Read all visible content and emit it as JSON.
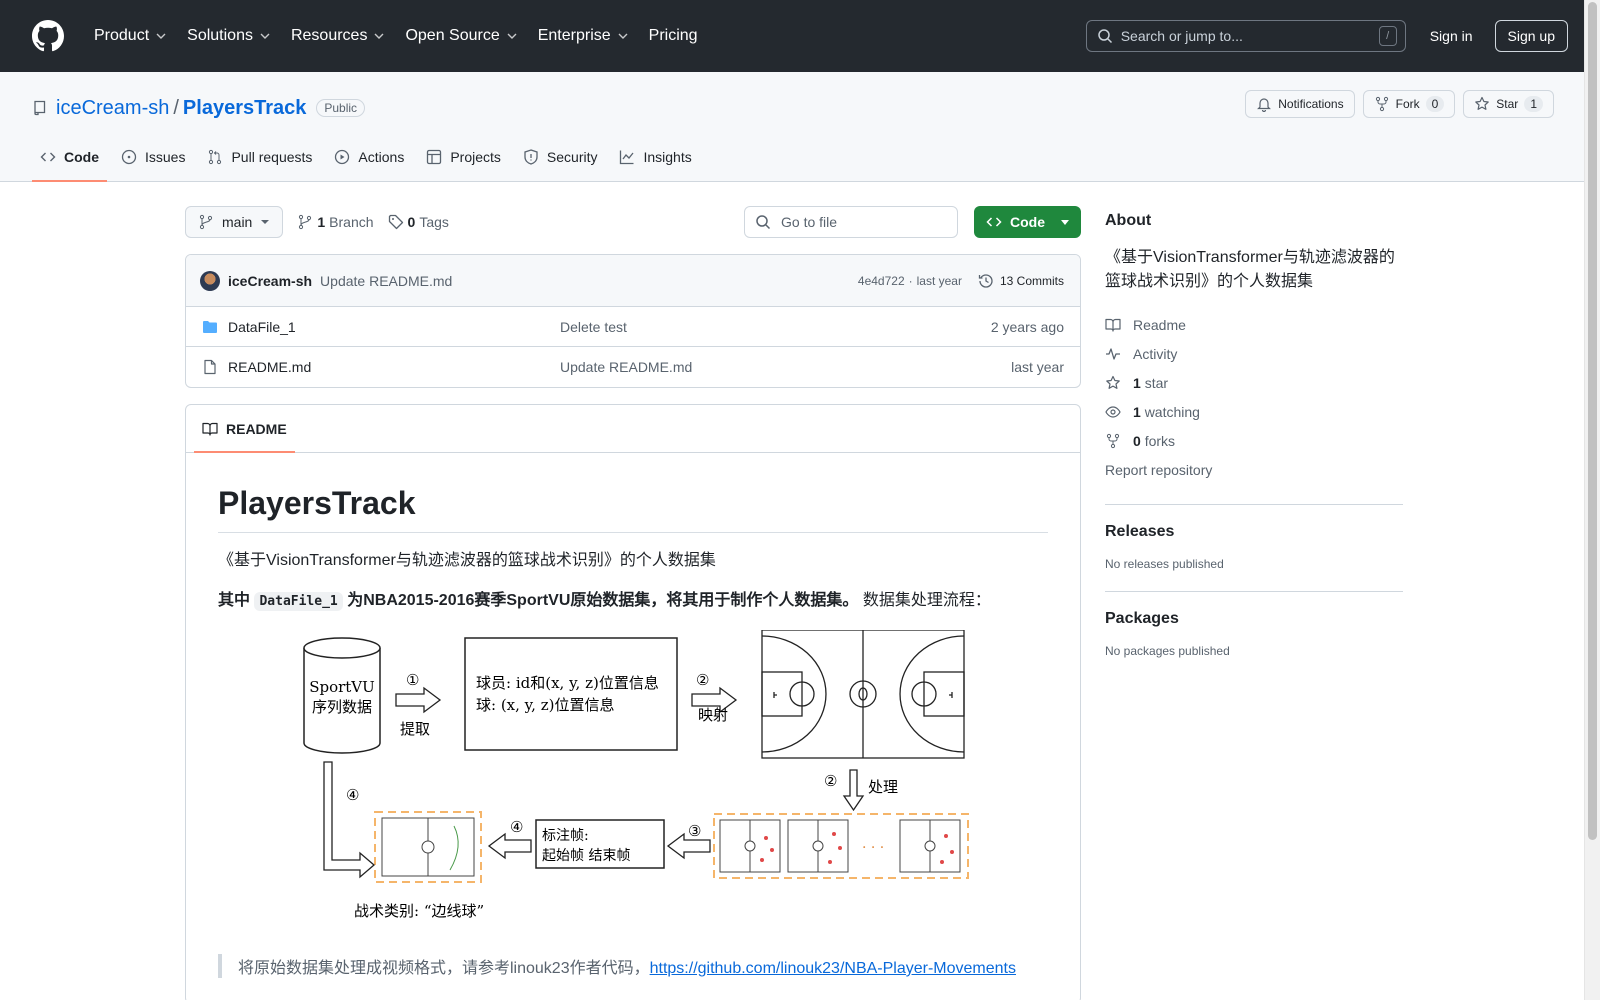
{
  "header": {
    "nav": [
      "Product",
      "Solutions",
      "Resources",
      "Open Source",
      "Enterprise",
      "Pricing"
    ],
    "search_placeholder": "Search or jump to...",
    "search_shortcut": "/",
    "sign_in": "Sign in",
    "sign_up": "Sign up"
  },
  "repo": {
    "owner": "iceCream-sh",
    "separator": "/",
    "name": "PlayersTrack",
    "visibility": "Public",
    "notifications_label": "Notifications",
    "fork_label": "Fork",
    "fork_count": "0",
    "star_label": "Star",
    "star_count": "1",
    "tabs": [
      "Code",
      "Issues",
      "Pull requests",
      "Actions",
      "Projects",
      "Security",
      "Insights"
    ]
  },
  "toolbar": {
    "branch": "main",
    "branch_count": "1",
    "branch_label": "Branch",
    "tag_count": "0",
    "tag_label": "Tags",
    "goto_placeholder": "Go to file",
    "code_button": "Code"
  },
  "commit": {
    "author": "iceCream-sh",
    "message": "Update README.md",
    "hash": "4e4d722",
    "separator": "·",
    "age": "last year",
    "commits": "13 Commits"
  },
  "files": [
    {
      "name": "DataFile_1",
      "type": "folder",
      "message": "Delete test",
      "age": "2 years ago"
    },
    {
      "name": "README.md",
      "type": "file",
      "message": "Update README.md",
      "age": "last year"
    }
  ],
  "readme": {
    "tab": "README",
    "title": "PlayersTrack",
    "intro": "《基于VisionTransformer与轨迹滤波器的篮球战术识别》的个人数据集",
    "bold_prefix": "其中",
    "code": "DataFile_1",
    "bold_suffix": "为NBA2015-2016赛季SportVU原始数据集，将其用于制作个人数据集。",
    "plain_suffix": " 数据集处理流程：",
    "diagram": {
      "db_line1": "SportVU",
      "db_line2": "序列数据",
      "step1_num": "①",
      "step1_label": "提取",
      "box_line1": "球员: id和(x, y, z)位置信息",
      "box_line2": "球: (x, y, z)位置信息",
      "step2_num": "②",
      "step2_label": "映射",
      "step2b_num": "②",
      "step2b_label": "处理",
      "step3_num": "③",
      "step4a_num": "④",
      "step4b_num": "④",
      "label_line1": "标注帧:",
      "label_line2": "起始帧    结束帧",
      "ellipsis": "· · ·",
      "tactic_label": "战术类别: “边线球”"
    },
    "quote_text": "将原始数据集处理成视频格式，请参考linouk23作者代码，",
    "quote_link": "https://github.com/linouk23/NBA-Player-Movements"
  },
  "sidebar": {
    "about_title": "About",
    "about_desc": "《基于VisionTransformer与轨迹滤波器的篮球战术识别》的个人数据集",
    "readme": "Readme",
    "activity": "Activity",
    "stars_count": "1",
    "stars_label": "star",
    "watching_count": "1",
    "watching_label": "watching",
    "forks_count": "0",
    "forks_label": "forks",
    "report": "Report repository",
    "releases_title": "Releases",
    "releases_empty": "No releases published",
    "packages_title": "Packages",
    "packages_empty": "No packages published"
  },
  "colors": {
    "header_bg": "#24292f",
    "link": "#0969da",
    "primary_button": "#1f883d",
    "tab_underline": "#fd8c73",
    "diagram_dash": "#f5b56a"
  }
}
